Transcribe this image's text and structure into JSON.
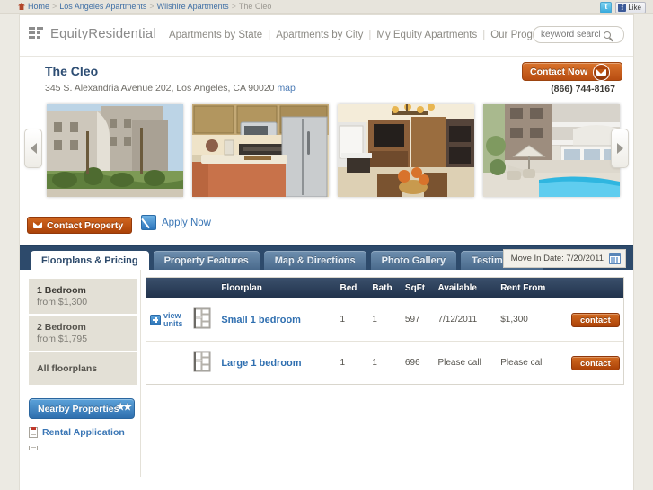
{
  "breadcrumb": {
    "home": "Home",
    "items": [
      "Los Angeles Apartments",
      "Wilshire Apartments"
    ],
    "current": "The Cleo",
    "separator": ">"
  },
  "social": {
    "twitter_icon": "twitter-icon",
    "facebook_like_label": "Like"
  },
  "header": {
    "logo_text_1": "Equity",
    "logo_text_2": "Residential",
    "nav": [
      "Apartments by State",
      "Apartments by City",
      "My Equity Apartments",
      "Our Programs"
    ],
    "nav_separator": "|",
    "search_placeholder": "keyword search",
    "search_value": "",
    "search_icon": "search-icon"
  },
  "property": {
    "name": "The Cleo",
    "address": "345 S. Alexandria Avenue 202, Los Angeles, CA 90020",
    "map_link": "map",
    "contact_now_label": "Contact Now",
    "phone": "(866) 744-8167"
  },
  "carousel": {
    "prev_label": "‹",
    "next_label": "›",
    "photos": [
      {
        "alt": "Apartment building exterior with landscaping"
      },
      {
        "alt": "Kitchen with stainless steel appliances"
      },
      {
        "alt": "Living and dining room interior"
      },
      {
        "alt": "Courtyard pool area"
      }
    ]
  },
  "actions": {
    "contact_property_label": "Contact Property",
    "apply_now_label": "Apply Now"
  },
  "tabs": [
    {
      "label": "Floorplans & Pricing",
      "active": true
    },
    {
      "label": "Property Features",
      "active": false
    },
    {
      "label": "Map & Directions",
      "active": false
    },
    {
      "label": "Photo Gallery",
      "active": false
    },
    {
      "label": "Testimonials",
      "active": false
    }
  ],
  "move_in": {
    "label": "Move In Date: 7/20/2011",
    "calendar_icon": "calendar-icon"
  },
  "sidebar": {
    "floorplan_filters": [
      {
        "title": "1 Bedroom",
        "subtitle": "from $1,300",
        "selected": true
      },
      {
        "title": "2 Bedroom",
        "subtitle": "from $1,795",
        "selected": false
      },
      {
        "title": "All floorplans",
        "subtitle": "",
        "selected": false
      }
    ],
    "nearby_label": "Nearby Properties",
    "links": [
      {
        "label": "Rental Application"
      }
    ]
  },
  "table": {
    "columns": [
      "Floorplan",
      "Bed",
      "Bath",
      "SqFt",
      "Available",
      "Rent From"
    ],
    "view_units_label_line1": "view",
    "view_units_label_line2": "units",
    "rows": [
      {
        "expandable": true,
        "name": "Small 1 bedroom",
        "bed": "1",
        "bath": "1",
        "sqft": "597",
        "available": "7/12/2011",
        "rent_from": "$1,300",
        "action": "contact"
      },
      {
        "expandable": false,
        "name": "Large 1 bedroom",
        "bed": "1",
        "bath": "1",
        "sqft": "696",
        "available": "Please call",
        "rent_from": "Please call",
        "action": "contact"
      }
    ]
  },
  "colors": {
    "page_background": "#eceae3",
    "navy": "#2d4a6b",
    "orange": "#b84d11",
    "link_blue": "#3a76b5",
    "table_header": "#20324b"
  }
}
